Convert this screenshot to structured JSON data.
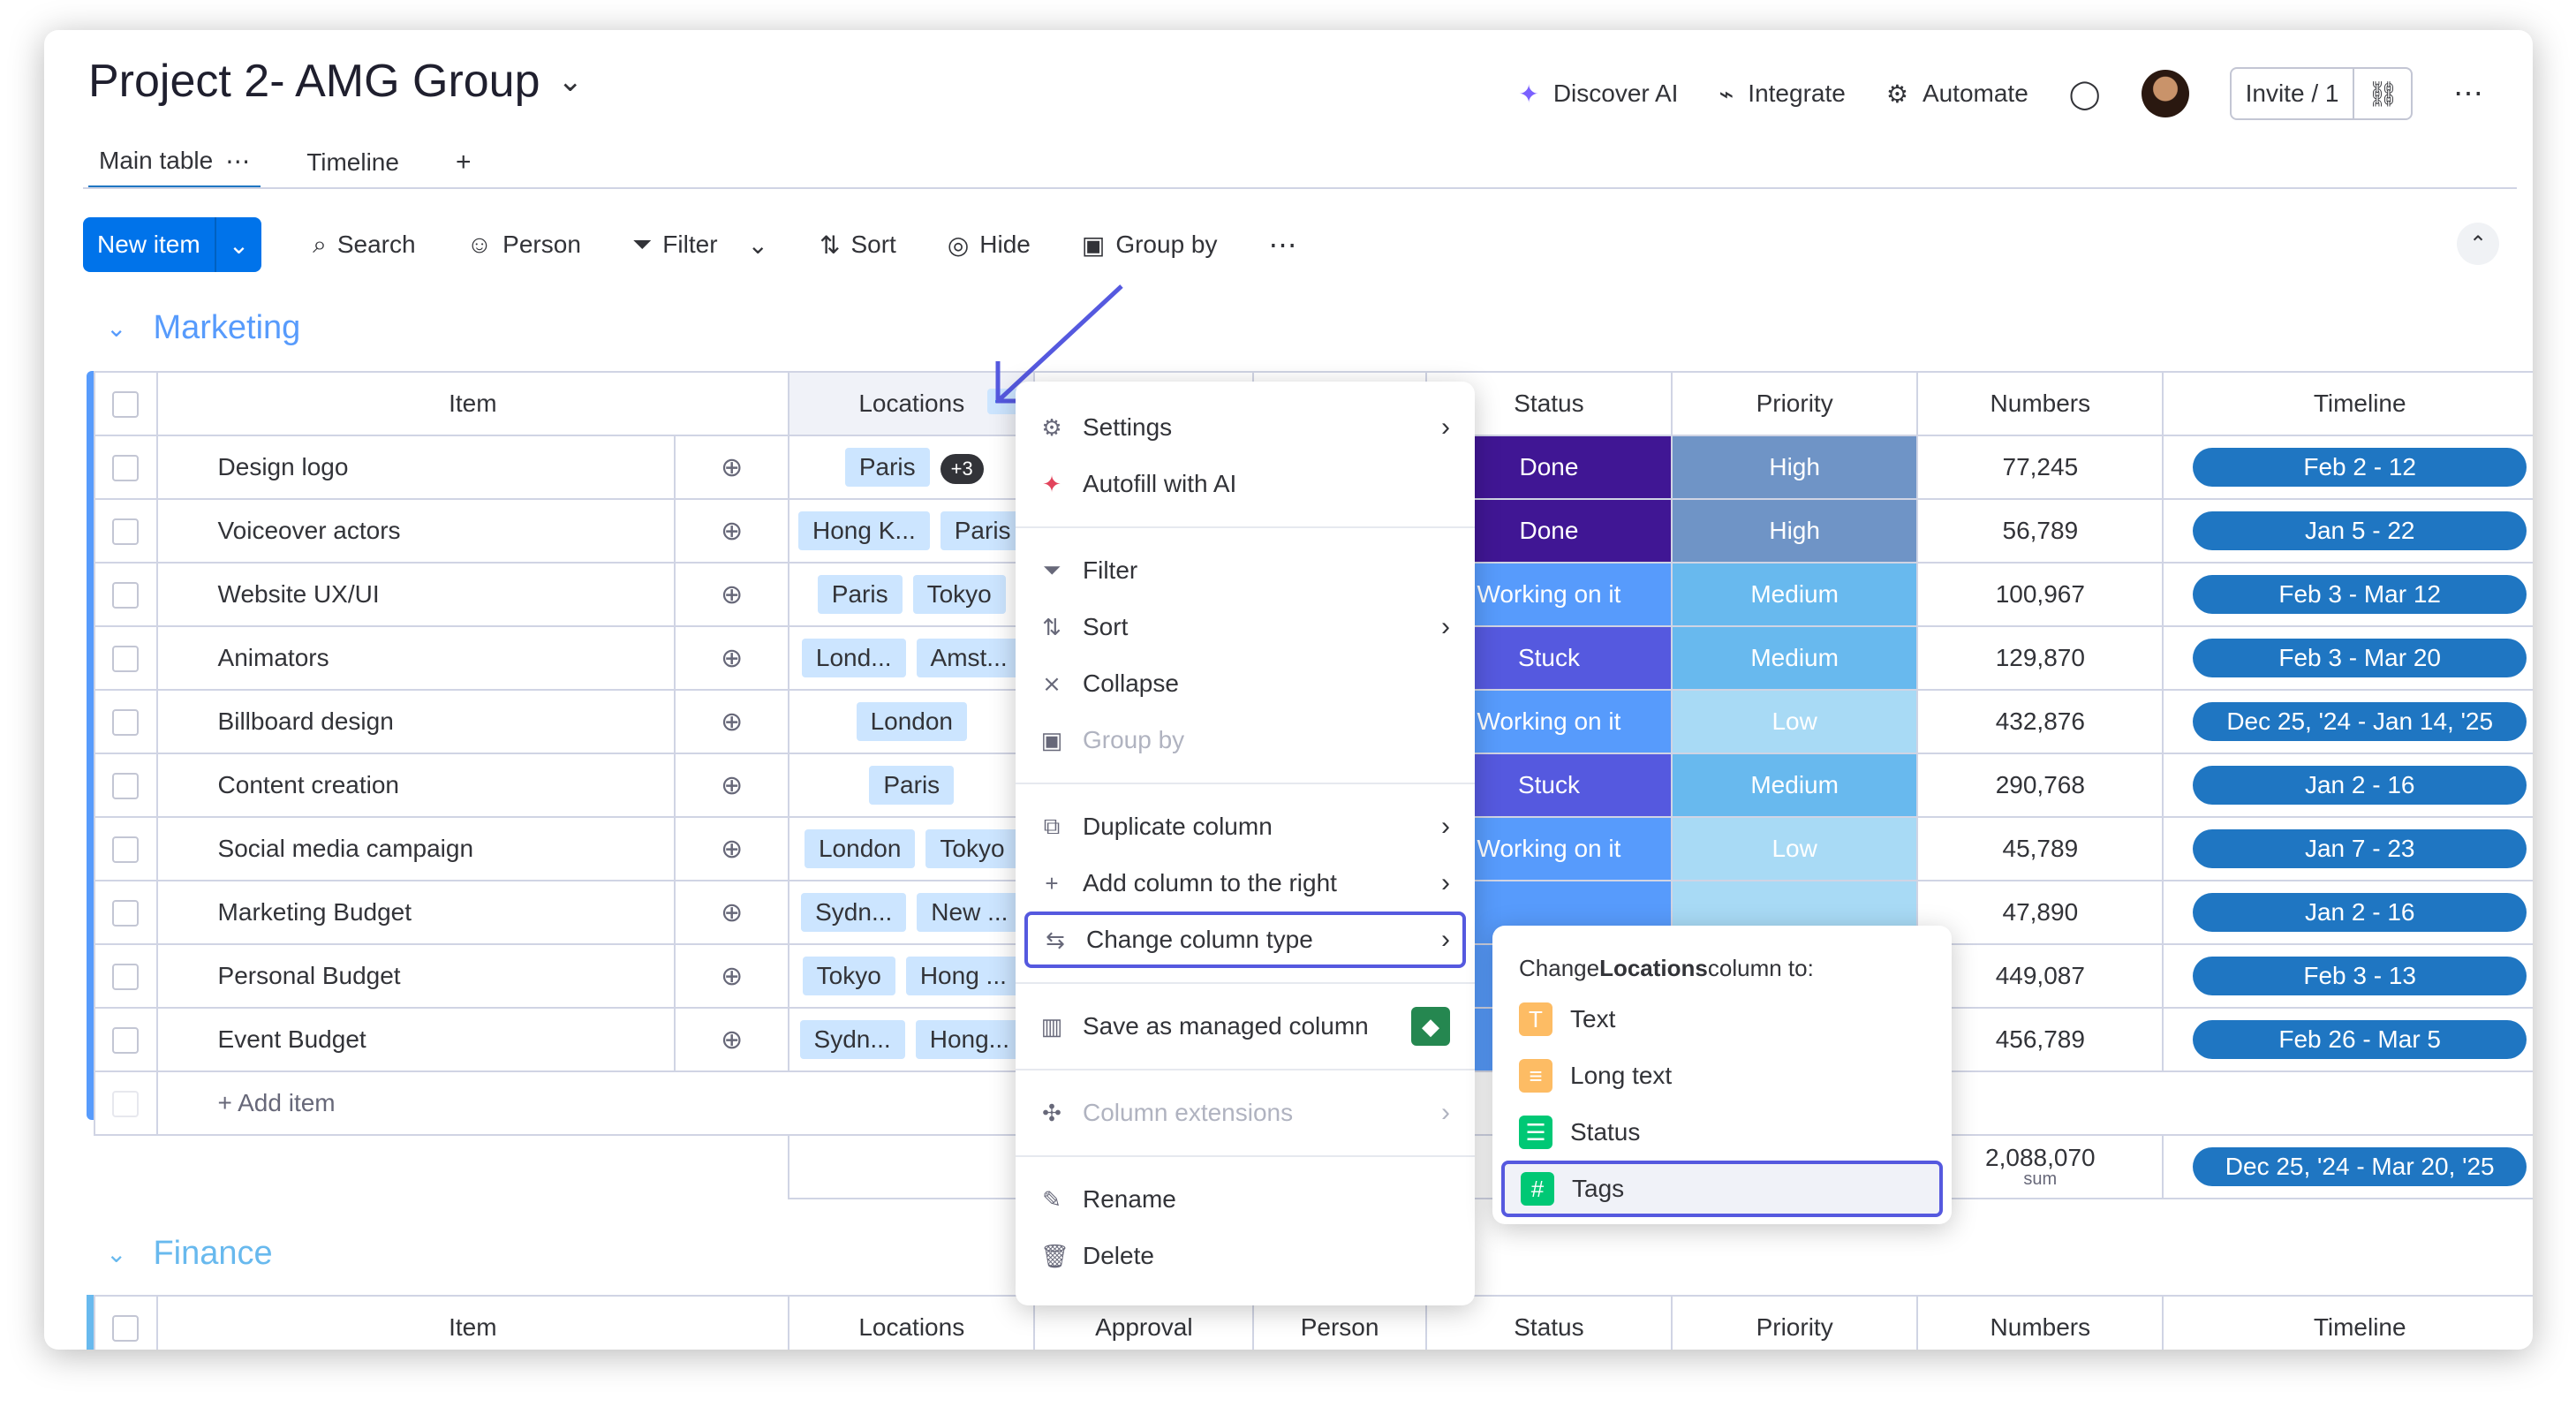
{
  "header": {
    "title": "Project 2- AMG Group",
    "discover_ai": "Discover AI",
    "integrate": "Integrate",
    "automate": "Automate",
    "invite": "Invite / 1"
  },
  "tabs": [
    {
      "label": "Main table"
    },
    {
      "label": "Timeline"
    },
    {
      "label": "+"
    }
  ],
  "toolbar": {
    "new_item": "New item",
    "search": "Search",
    "person": "Person",
    "filter": "Filter",
    "sort": "Sort",
    "hide": "Hide",
    "group_by": "Group by"
  },
  "groups": {
    "marketing": "Marketing",
    "finance": "Finance"
  },
  "columns": {
    "item": "Item",
    "locations": "Locations",
    "approval": "Approval",
    "person": "Person",
    "status": "Status",
    "priority": "Priority",
    "numbers": "Numbers",
    "timeline": "Timeline"
  },
  "rows": [
    {
      "item": "Design logo",
      "loc": [
        "Paris"
      ],
      "more": "+3",
      "status": "Done",
      "priority": "High",
      "number": "77,245",
      "timeline": "Feb 2 - 12"
    },
    {
      "item": "Voiceover actors",
      "loc": [
        "Hong K...",
        "Paris"
      ],
      "status": "Done",
      "priority": "High",
      "number": "56,789",
      "timeline": "Jan 5 - 22"
    },
    {
      "item": "Website UX/UI",
      "loc": [
        "Paris",
        "Tokyo"
      ],
      "status": "Working on it",
      "priority": "Medium",
      "number": "100,967",
      "timeline": "Feb 3 - Mar 12"
    },
    {
      "item": "Animators",
      "loc": [
        "Lond...",
        "Amst..."
      ],
      "status": "Stuck",
      "priority": "Medium",
      "number": "129,870",
      "timeline": "Feb 3 - Mar 20"
    },
    {
      "item": "Billboard design",
      "loc": [
        "London"
      ],
      "status": "Working on it",
      "priority": "Low",
      "number": "432,876",
      "timeline": "Dec 25, '24 - Jan 14, '25"
    },
    {
      "item": "Content creation",
      "loc": [
        "Paris"
      ],
      "status": "Stuck",
      "priority": "Medium",
      "number": "290,768",
      "timeline": "Jan 2 - 16"
    },
    {
      "item": "Social media campaign",
      "loc": [
        "London",
        "Tokyo"
      ],
      "status": "Working on it",
      "priority": "Low",
      "number": "45,789",
      "timeline": "Jan 7 - 23"
    },
    {
      "item": "Marketing Budget",
      "loc": [
        "Sydn...",
        "New ..."
      ],
      "status": "",
      "priority": "",
      "number": "47,890",
      "timeline": "Jan 2 - 16"
    },
    {
      "item": "Personal Budget",
      "loc": [
        "Tokyo",
        "Hong ..."
      ],
      "status": "",
      "priority": "",
      "number": "449,087",
      "timeline": "Feb 3 - 13"
    },
    {
      "item": "Event Budget",
      "loc": [
        "Sydn...",
        "Hong..."
      ],
      "status": "",
      "priority": "",
      "number": "456,789",
      "timeline": "Feb 26 - Mar 5"
    }
  ],
  "add_item": "+ Add item",
  "summary": {
    "number": "2,088,070",
    "number_label": "sum",
    "timeline": "Dec 25, '24 - Mar 20, '25"
  },
  "menu": {
    "settings": "Settings",
    "autofill": "Autofill with AI",
    "filter": "Filter",
    "sort": "Sort",
    "collapse": "Collapse",
    "group_by": "Group by",
    "duplicate": "Duplicate column",
    "add_right": "Add column to the right",
    "change_type": "Change column type",
    "save_managed": "Save as managed column",
    "extensions": "Column extensions",
    "rename": "Rename",
    "delete": "Delete"
  },
  "submenu": {
    "prefix": "Change ",
    "bold": "Locations",
    "suffix": " column to:",
    "text": "Text",
    "long_text": "Long text",
    "status": "Status",
    "tags": "Tags"
  },
  "colors": {
    "done": "#401694",
    "stuck": "#5559df",
    "working": "#579bfc",
    "high": "#6f94c6",
    "medium": "#68b9ee",
    "low": "#a8daf5",
    "accent": "#0073ea",
    "timeline": "#1f76c2"
  }
}
